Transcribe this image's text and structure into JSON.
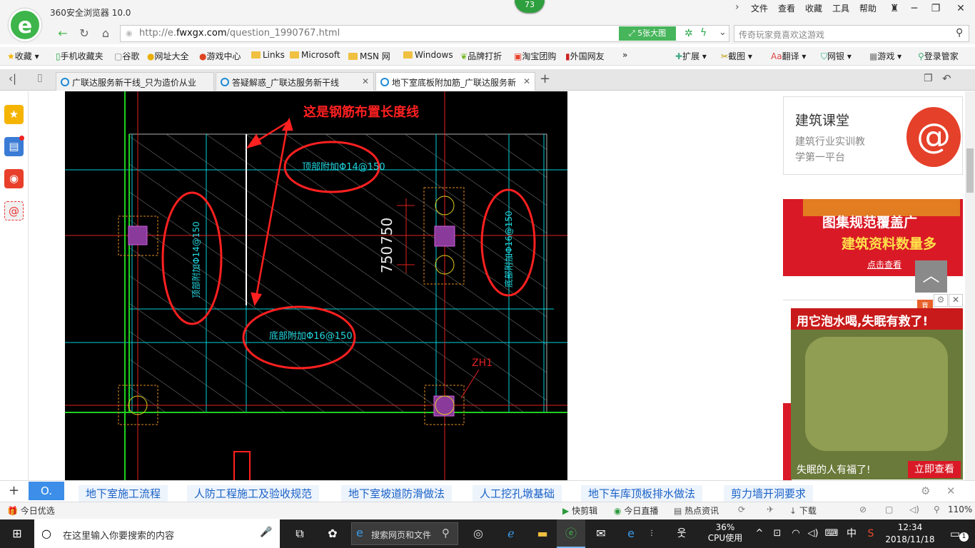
{
  "browser": {
    "app_title": "360安全浏览器 10.0",
    "badge_count": "73",
    "menu": [
      "文件",
      "查看",
      "收藏",
      "工具",
      "帮助"
    ],
    "url_prefix": "http://e.",
    "url_domain": "fwxgx.com",
    "url_path": "/question_1990767.html",
    "big_pic_label": "5张大图",
    "search_placeholder": "传奇玩家竟喜欢这游戏",
    "bookmarks": [
      "收藏",
      "手机收藏夹",
      "谷歌",
      "网址大全",
      "游戏中心",
      "Links",
      "Microsoft",
      "MSN 网",
      "Windows",
      "品牌打折",
      "淘宝团购",
      "外国网友",
      "»"
    ],
    "toolbar_right": [
      "扩展",
      "截图",
      "翻译",
      "网银",
      "游戏",
      "登录管家"
    ],
    "tabs": [
      {
        "label": "广联达服务新干线_只为造价从业",
        "active": false
      },
      {
        "label": "答疑解惑_广联达服务新干线",
        "active": false
      },
      {
        "label": "地下室底板附加筋_广联达服务新",
        "active": true
      }
    ]
  },
  "drawing": {
    "annotation": "这是钢筋布置长度线",
    "label_top": "顶部附加Φ14@150",
    "label_left": "顶部附加Φ14@150",
    "label_right": "底部附加Φ16@150",
    "label_bottom": "底部附加Φ16@150",
    "dim1": "750",
    "dim2": "750",
    "zh": "ZH1"
  },
  "sidebar_right": {
    "card1_title": "建筑课堂",
    "card1_sub1": "建筑行业实训教",
    "card1_sub2": "学第一平台",
    "banner_line1": "图集规范覆盖广",
    "banner_line2": "建筑资料数量多",
    "banner_link": "点击查看",
    "ad_title": "用它泡水喝,失眠有救了!",
    "ad_caption": "失眠的人有福了!",
    "ad_button": "立即查看",
    "ad_corner": "育"
  },
  "keywords": [
    "地下室施工流程",
    "人防工程施工及验收规范",
    "地下室坡道防滑做法",
    "人工挖孔墩基础",
    "地下车库顶板排水做法",
    "剪力墙开洞要求"
  ],
  "status": {
    "left": "今日优选",
    "items": [
      "快剪辑",
      "今日直播",
      "热点资讯",
      "下载"
    ],
    "zoom": "110%"
  },
  "taskbar": {
    "search_placeholder": "在这里输入你要搜索的内容",
    "search_pages": "搜索网页和文件",
    "cpu_percent": "36%",
    "cpu_label": "CPU使用",
    "ime": "中",
    "time": "12:34",
    "date": "2018/11/18",
    "notifications": "1"
  }
}
